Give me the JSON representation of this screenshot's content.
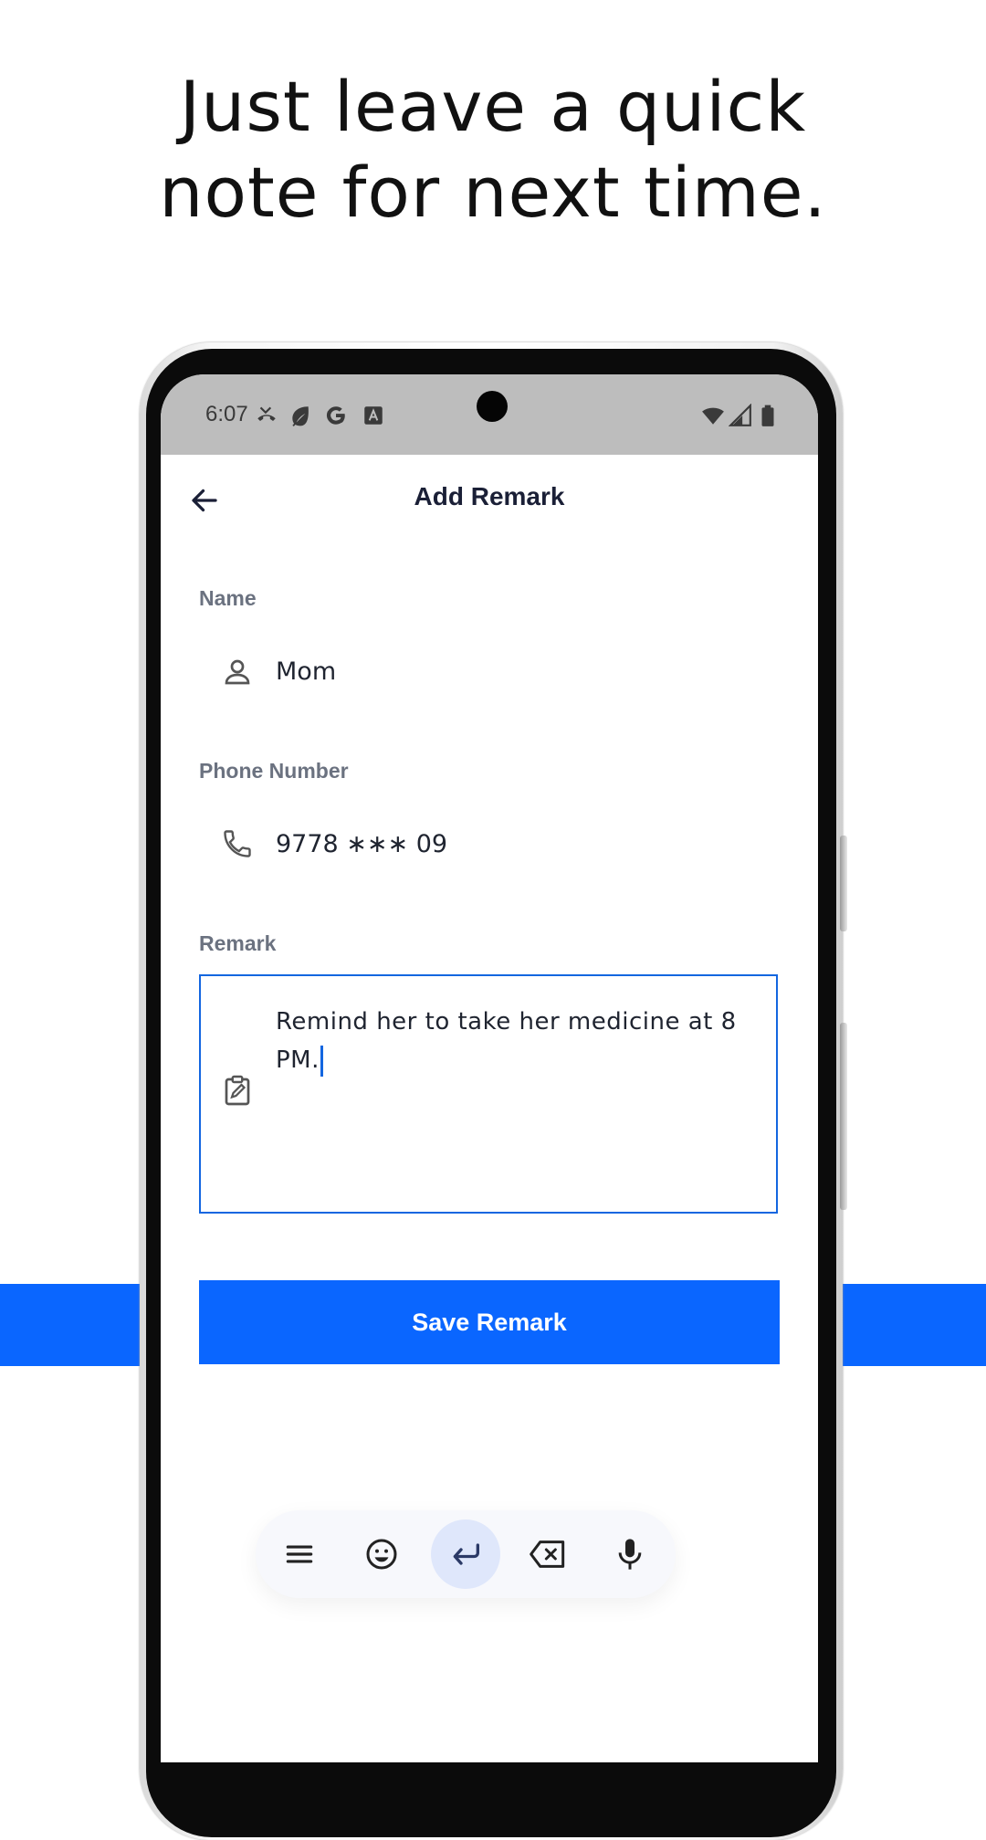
{
  "promo": {
    "headline_line1": "Just leave a quick",
    "headline_line2": "note for next time."
  },
  "status_bar": {
    "time": "6:07",
    "left_icons": [
      "missed-call-icon",
      "leaf-icon",
      "google-icon",
      "font-a-icon"
    ],
    "right_icons": [
      "wifi-icon",
      "signal-icon",
      "battery-icon"
    ]
  },
  "app_bar": {
    "title": "Add Remark",
    "back_icon": "arrow-left-icon"
  },
  "form": {
    "name": {
      "label": "Name",
      "value": "Mom",
      "icon": "person-icon"
    },
    "phone": {
      "label": "Phone Number",
      "value": "9778 ∗∗∗ 09",
      "icon": "phone-icon"
    },
    "remark": {
      "label": "Remark",
      "value": "Remind her to take her medicine at 8 PM.",
      "icon": "clipboard-edit-icon"
    }
  },
  "save_button": {
    "label": "Save Remark"
  },
  "keyboard_toolbar": {
    "keys": [
      "menu-icon",
      "emoji-icon",
      "enter-icon",
      "backspace-icon",
      "microphone-icon"
    ],
    "active": "enter-icon"
  },
  "colors": {
    "accent": "#0a66ff",
    "focus_border": "#1366e0",
    "label_gray": "#6b7280",
    "title_dark": "#1a1f36"
  }
}
